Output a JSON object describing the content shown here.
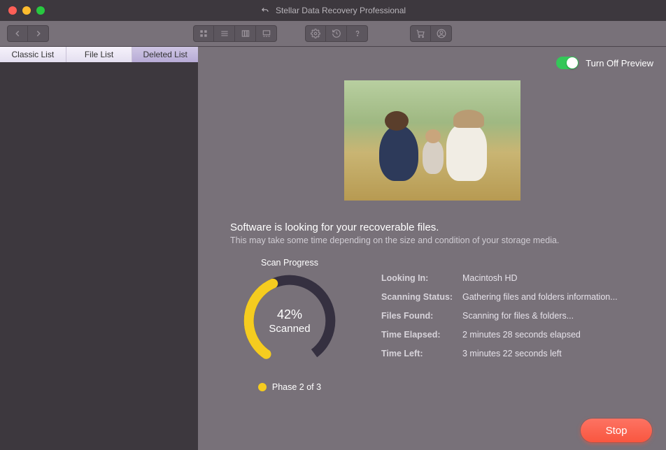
{
  "title": "Stellar Data Recovery Professional",
  "tabs": {
    "classic": "Classic List",
    "file": "File List",
    "deleted": "Deleted List"
  },
  "preview_toggle_label": "Turn Off Preview",
  "status": {
    "title": "Software is looking for your recoverable files.",
    "subtitle": "This may take some time depending on the size and condition of your storage media."
  },
  "progress": {
    "label": "Scan Progress",
    "percent_text": "42%",
    "percent_value": 42,
    "scanned_word": "Scanned",
    "phase": "Phase 2 of 3"
  },
  "info": {
    "looking_in_k": "Looking In:",
    "looking_in_v": "Macintosh HD",
    "scanning_status_k": "Scanning Status:",
    "scanning_status_v": "Gathering files and folders information...",
    "files_found_k": "Files Found:",
    "files_found_v": "Scanning for files & folders...",
    "time_elapsed_k": "Time Elapsed:",
    "time_elapsed_v": "2 minutes 28 seconds elapsed",
    "time_left_k": "Time Left:",
    "time_left_v": "3 minutes 22 seconds left"
  },
  "footer": {
    "stop": "Stop"
  }
}
